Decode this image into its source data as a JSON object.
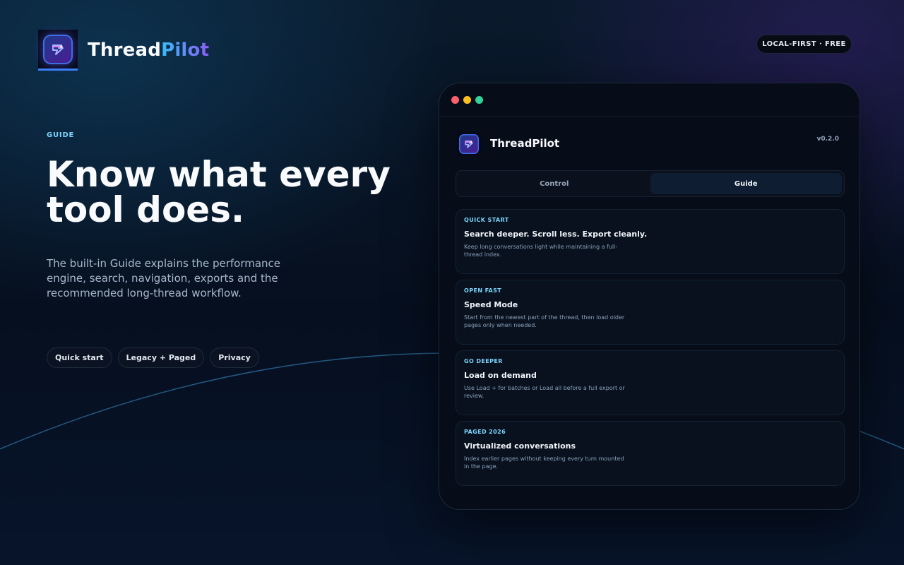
{
  "brand": {
    "name_part1": "Thread",
    "name_part2": "Pilot",
    "badge": "LOCAL-FIRST · FREE"
  },
  "hero": {
    "eyebrow": "GUIDE",
    "title": "Know what every tool does.",
    "description": "The built-in Guide explains the performance engine, search, navigation, exports and the recommended long-thread workflow.",
    "chips": [
      "Quick start",
      "Legacy + Paged",
      "Privacy"
    ]
  },
  "window": {
    "app_name": "ThreadPilot",
    "version": "v0.2.0",
    "tabs": [
      {
        "label": "Control",
        "active": false
      },
      {
        "label": "Guide",
        "active": true
      }
    ],
    "cards": [
      {
        "eyebrow": "QUICK START",
        "title": "Search deeper. Scroll less. Export cleanly.",
        "desc": "Keep long conversations light while maintaining a full-thread index."
      },
      {
        "eyebrow": "OPEN FAST",
        "title": "Speed Mode",
        "desc": "Start from the newest part of the thread, then load older pages only when needed."
      },
      {
        "eyebrow": "GO DEEPER",
        "title": "Load on demand",
        "desc": "Use Load + for batches or Load all before a full export or review."
      },
      {
        "eyebrow": "PAGED 2026",
        "title": "Virtualized conversations",
        "desc": "Index earlier pages without keeping every turn mounted in the page."
      }
    ]
  },
  "colors": {
    "accent_cyan": "#7dd3fc",
    "accent_blue": "#38bdf8",
    "accent_violet": "#8b5cf6",
    "traffic_red": "#ff5f6d",
    "traffic_yellow": "#fbbf24",
    "traffic_green": "#34d399"
  },
  "icons": {
    "logo": "threadpilot-logo-icon"
  }
}
